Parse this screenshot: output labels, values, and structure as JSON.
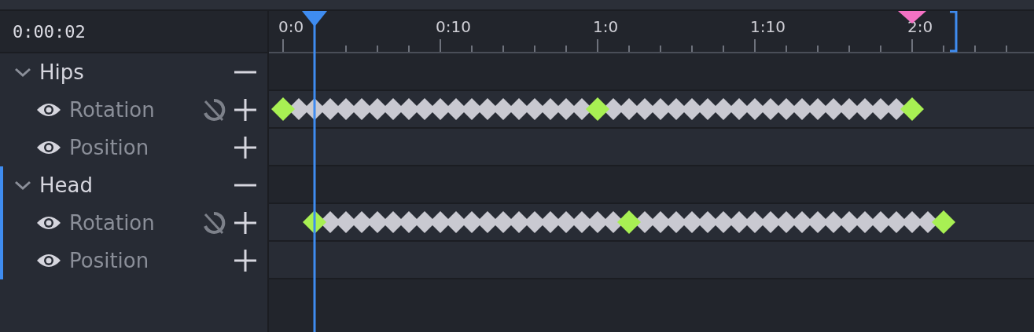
{
  "timecode": "0:00:02",
  "ruler": {
    "labels": [
      "0:0",
      "0:10",
      "1:0",
      "1:10",
      "2:0"
    ]
  },
  "tracks": [
    {
      "name": "Hips",
      "expanded": true,
      "selected": false,
      "properties": [
        {
          "name": "Rotation",
          "kind": "rotation",
          "visible": true,
          "animated": true
        },
        {
          "name": "Position",
          "kind": "position",
          "visible": true,
          "animated": false
        }
      ]
    },
    {
      "name": "Head",
      "expanded": true,
      "selected": true,
      "properties": [
        {
          "name": "Rotation",
          "kind": "rotation",
          "visible": true,
          "animated": true
        },
        {
          "name": "Position",
          "kind": "position",
          "visible": true,
          "animated": false
        }
      ]
    }
  ]
}
